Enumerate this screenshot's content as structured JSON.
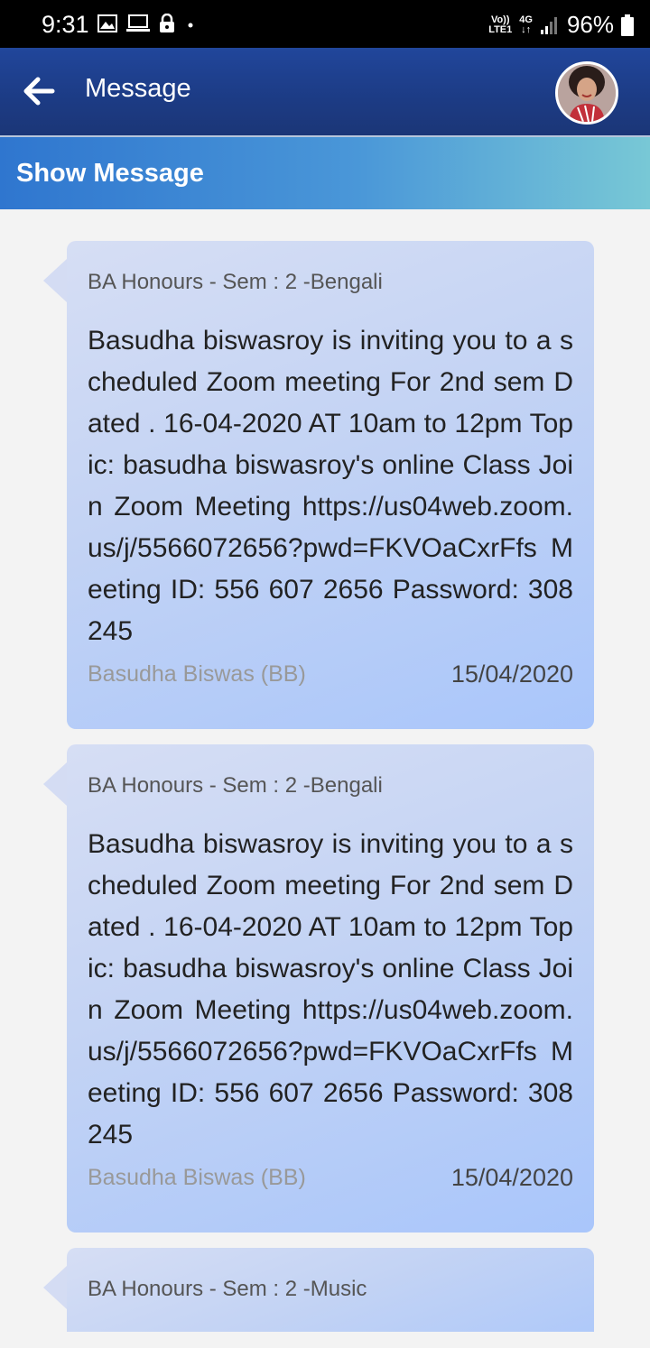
{
  "status_bar": {
    "time": "9:31",
    "network_top": "Vo))",
    "network_bottom": "LTE1",
    "network_gen": "4G",
    "battery": "96%"
  },
  "app_bar": {
    "title": "Message"
  },
  "sub_header": {
    "title": "Show Message"
  },
  "messages": [
    {
      "course": "BA Honours - Sem : 2 -Bengali",
      "body": "Basudha biswasroy is inviting you to a scheduled Zoom meeting For 2nd sem Dated . 16-04-2020  AT 10am to 12pm   Topic: basudha biswasroy's online Class Join Zoom Meeting https://us04web.zoom.us/j/5566072656?pwd=FKVOaCxrFfs Meeting ID: 556 607 2656 Password: 308245",
      "sender": "Basudha Biswas (BB)",
      "date": "15/04/2020"
    },
    {
      "course": "BA Honours - Sem : 2 -Bengali",
      "body": "Basudha biswasroy is inviting you to a scheduled Zoom meeting For 2nd sem Dated . 16-04-2020  AT 10am to 12pm   Topic: basudha biswasroy's online Class Join Zoom Meeting https://us04web.zoom.us/j/5566072656?pwd=FKVOaCxrFfs Meeting ID: 556 607 2656 Password: 308245",
      "sender": "Basudha Biswas (BB)",
      "date": "15/04/2020"
    },
    {
      "course": "BA Honours - Sem : 2 -Music"
    }
  ]
}
